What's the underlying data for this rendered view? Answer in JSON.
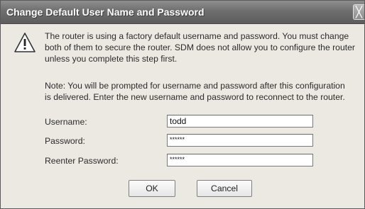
{
  "dialog": {
    "title": "Change Default User Name and Password",
    "close_glyph": "╳",
    "message": "The router is using a factory default username and password. You must change\nboth of them to secure the router. SDM does not allow you to configure the router\nunless you complete this step first.",
    "note": "Note: You will be prompted for username and password after this configuration\nis delivered. Enter the new username and password to reconnect to the router.",
    "icon": "warning-icon"
  },
  "form": {
    "username_label": "Username:",
    "username_value": "todd",
    "password_label": "Password:",
    "password_value": "******",
    "reenter_label": "Reenter Password:",
    "reenter_value": "******"
  },
  "buttons": {
    "ok_label": "OK",
    "cancel_label": "Cancel"
  }
}
